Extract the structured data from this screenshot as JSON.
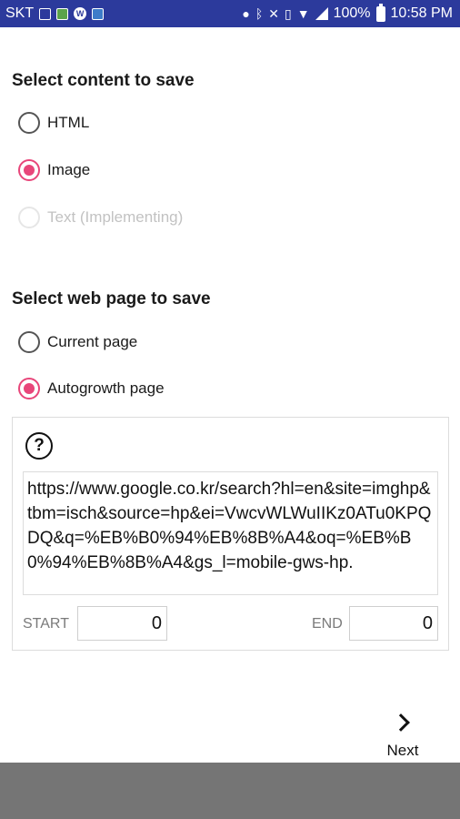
{
  "status_bar": {
    "carrier": "SKT",
    "battery_percent": "100%",
    "time": "10:58 PM",
    "color": "#2c3a9c",
    "icons": [
      "image-icon",
      "gallery-icon",
      "w-app-icon",
      "book-icon",
      "location-icon",
      "bluetooth-icon",
      "mute-icon",
      "vibrate-icon",
      "wifi-icon",
      "signal-icon",
      "battery-icon"
    ]
  },
  "content_section": {
    "title": "Select content to save",
    "options": [
      {
        "label": "HTML",
        "checked": false,
        "disabled": false
      },
      {
        "label": "Image",
        "checked": true,
        "disabled": false
      },
      {
        "label": "Text (Implementing)",
        "checked": false,
        "disabled": true
      }
    ]
  },
  "page_section": {
    "title": "Select web page to save",
    "options": [
      {
        "label": "Current page",
        "checked": false,
        "disabled": false
      },
      {
        "label": "Autogrowth page",
        "checked": true,
        "disabled": false
      }
    ]
  },
  "autogrowth": {
    "help_icon": "question-circle-icon",
    "help_glyph": "?",
    "url": "https://www.google.co.kr/search?hl=en&site=imghp&tbm=isch&source=hp&ei=VwcvWLWuIIKz0ATu0KPQDQ&q=%EB%B0%94%EB%8B%A4&oq=%EB%B0%94%EB%8B%A4&gs_l=mobile-gws-hp.",
    "start_label": "START",
    "start_value": "0",
    "end_label": "END",
    "end_value": "0"
  },
  "next_button": {
    "label": "Next",
    "icon": "chevron-right-icon"
  },
  "colors": {
    "accent": "#e8467a",
    "bottom_bar": "#757575"
  }
}
